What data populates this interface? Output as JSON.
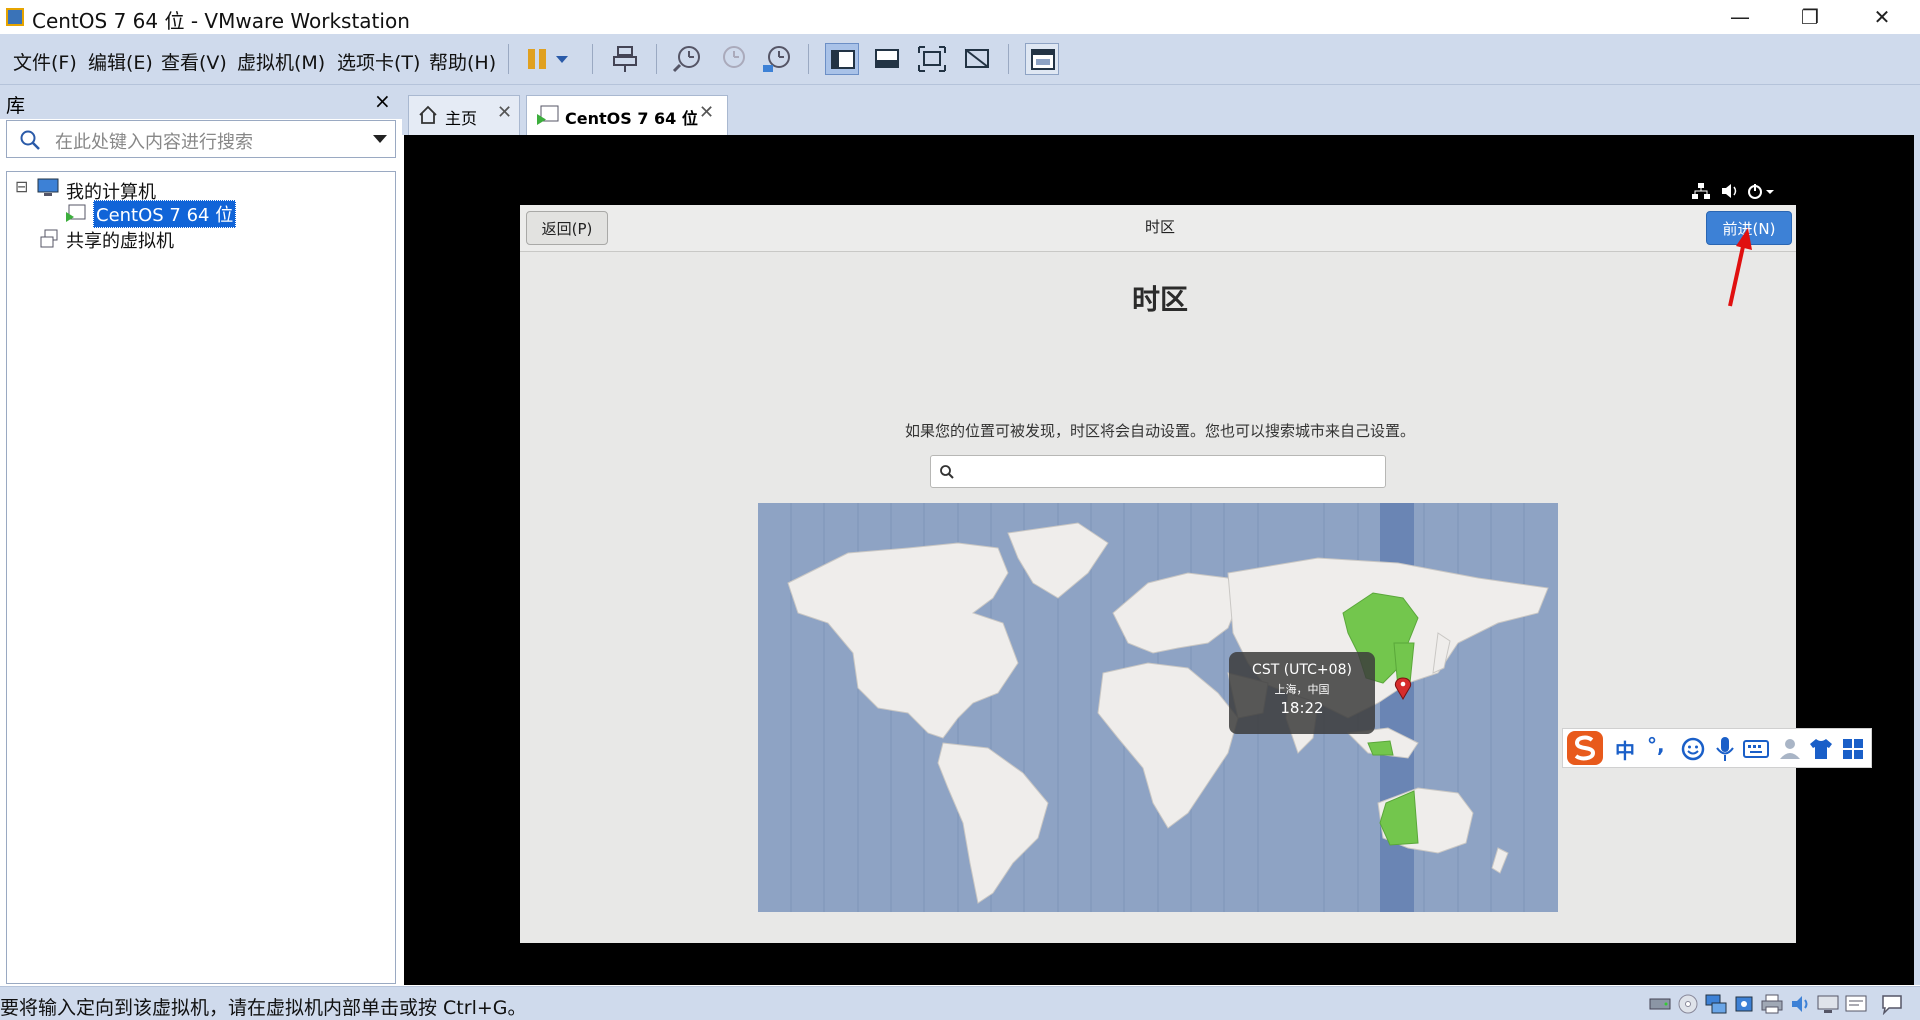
{
  "window": {
    "title": "CentOS 7 64 位 - VMware Workstation",
    "minimize_glyph": "—",
    "restore_glyph": "❐",
    "close_glyph": "✕"
  },
  "menu": [
    "文件(F)",
    "编辑(E)",
    "查看(V)",
    "虚拟机(M)",
    "选项卡(T)",
    "帮助(H)"
  ],
  "toolbar_icons": [
    "pause-icon",
    "dropdown-arrow-icon",
    "send-ctrl-alt-del-icon",
    "snapshot-icon",
    "revert-snapshot-icon",
    "snapshot-manager-icon",
    "show-library-icon",
    "thumbnail-bar-icon",
    "full-screen-icon",
    "unity-icon",
    "console-view-icon"
  ],
  "library": {
    "title": "库",
    "close": "×",
    "search_placeholder": "在此处键入内容进行搜索",
    "tree": {
      "root": "我的计算机",
      "vm": "CentOS 7 64 位",
      "shared": "共享的虚拟机",
      "toggle": "⊟"
    }
  },
  "tabs": [
    {
      "label": "主页",
      "close": "✕"
    },
    {
      "label": "CentOS 7 64 位",
      "close": "✕"
    }
  ],
  "installer": {
    "back": "返回(P)",
    "next": "前进(N)",
    "header_title": "时区",
    "title": "时区",
    "instruction": "如果您的位置可被发现，时区将会自动设置。您也可以搜索城市来自己设置。",
    "search_value": "",
    "tooltip": {
      "zone": "CST (UTC+08)",
      "city": "上海，中国",
      "time": "18:22"
    }
  },
  "ime": {
    "lang": "中",
    "punct": "°,"
  },
  "statusbar": {
    "message": "要将输入定向到该虚拟机，请在虚拟机内部单击或按 Ctrl+G。"
  },
  "colors": {
    "chrome": "#cfdaec",
    "accent": "#3d81d6",
    "map_ocean": "#8ea3c4",
    "land": "#efedeb",
    "selected_zone": "#73c64d"
  }
}
